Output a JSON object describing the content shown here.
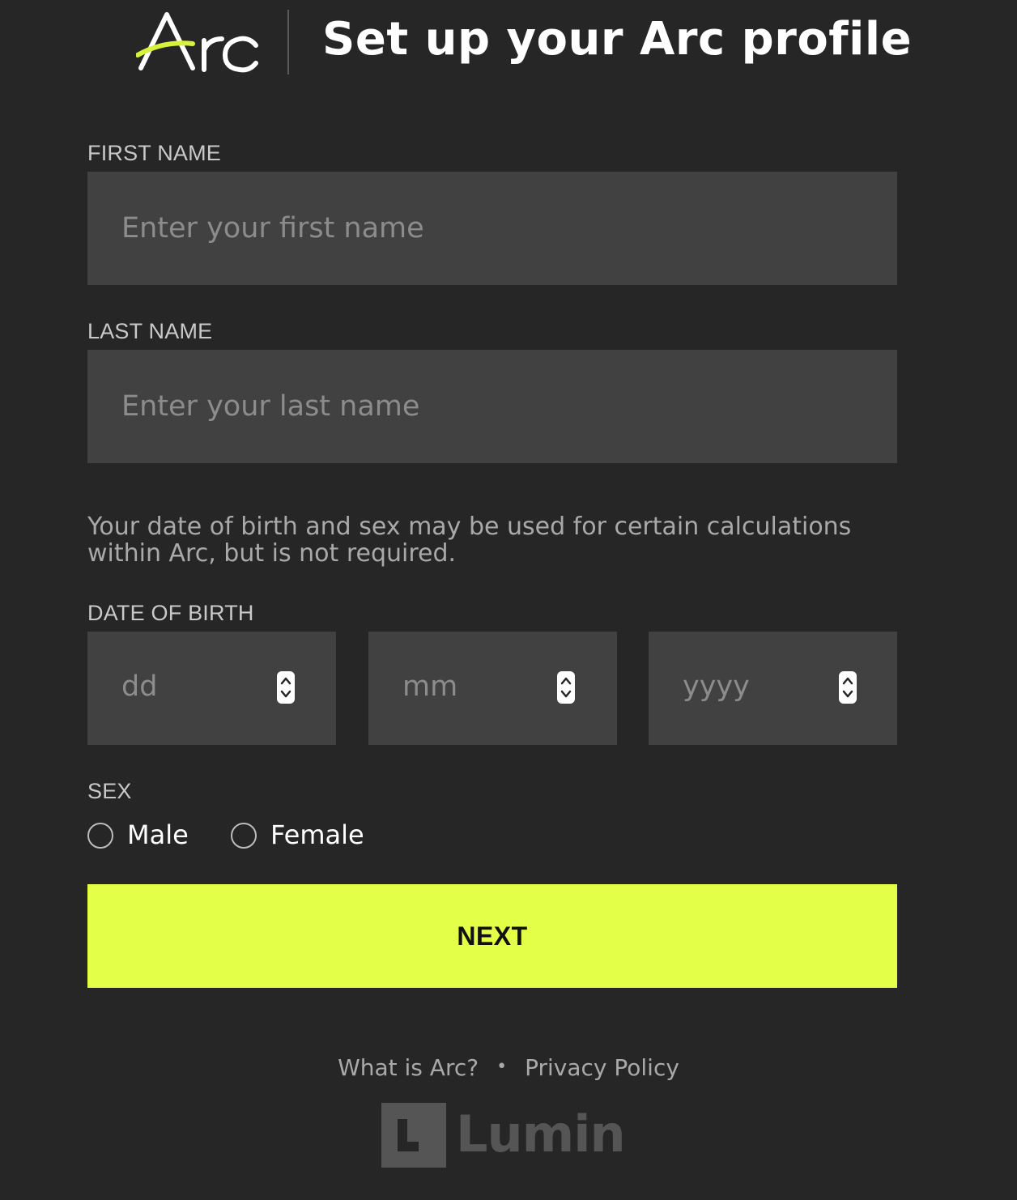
{
  "header": {
    "logo_text": "Arc",
    "title": "Set up your Arc profile"
  },
  "form": {
    "first_name": {
      "label": "FIRST NAME",
      "placeholder": "Enter your first name",
      "value": ""
    },
    "last_name": {
      "label": "LAST NAME",
      "placeholder": "Enter your last name",
      "value": ""
    },
    "info_text": "Your date of birth and sex may be used for certain calculations within Arc, but is not required.",
    "date_of_birth": {
      "label": "DATE OF BIRTH",
      "day_placeholder": "dd",
      "month_placeholder": "mm",
      "year_placeholder": "yyyy"
    },
    "sex": {
      "label": "SEX",
      "options": [
        "Male",
        "Female"
      ],
      "selected": null
    },
    "next_label": "NEXT"
  },
  "footer": {
    "what_is_arc": "What is Arc?",
    "separator": "•",
    "privacy_policy": "Privacy Policy",
    "brand": "Lumin"
  },
  "colors": {
    "background": "#262626",
    "input_background": "#414141",
    "accent": "#e3ff48"
  }
}
